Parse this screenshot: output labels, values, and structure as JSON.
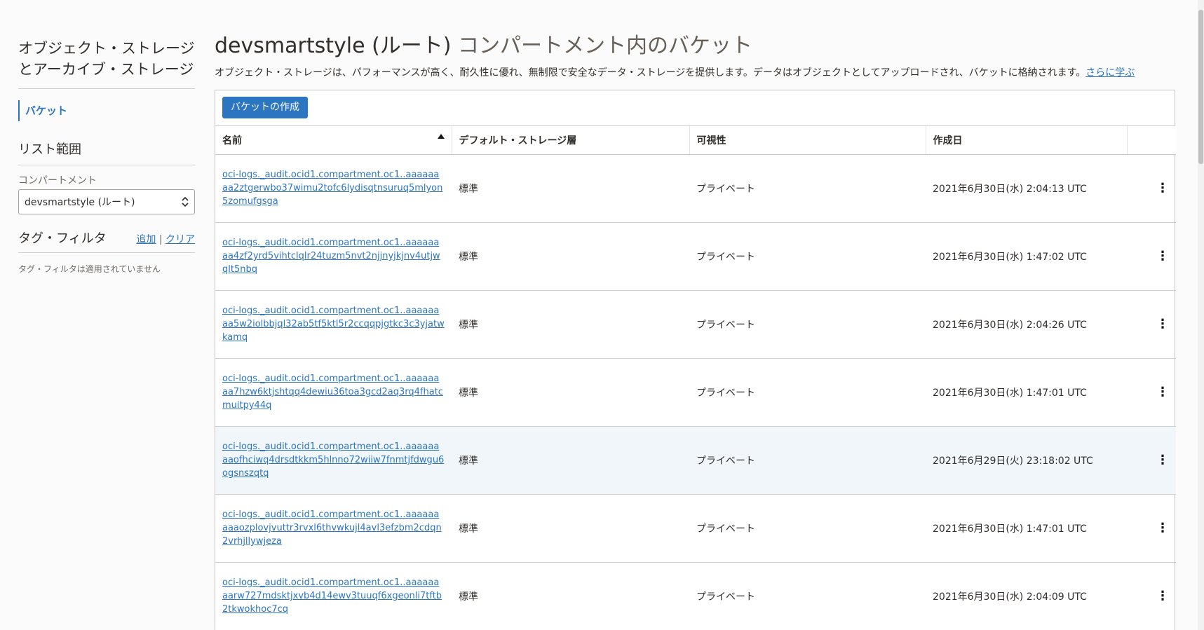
{
  "sidebar": {
    "title_line1": "オブジェクト・ストレージ",
    "title_line2": "とアーカイブ・ストレージ",
    "nav_buckets": "バケット",
    "list_scope": "リスト範囲",
    "compartment_label": "コンパートメント",
    "compartment_value": "devsmartstyle (ルート)",
    "tag_filter_title": "タグ・フィルタ",
    "tag_add": "追加",
    "tag_separator": "|",
    "tag_clear": "クリア",
    "tag_empty": "タグ・フィルタは適用されていません"
  },
  "main": {
    "title_compartment": "devsmartstyle (ルート)",
    "title_suffix": " コンパートメント内のバケット",
    "description": "オブジェクト・ストレージは、パフォーマンスが高く、耐久性に優れ、無制限で安全なデータ・ストレージを提供します。データはオブジェクトとしてアップロードされ、バケットに格納されます。",
    "learn_more": "さらに学ぶ",
    "create_button": "バケットの作成"
  },
  "table": {
    "headers": {
      "name": "名前",
      "tier": "デフォルト・ストレージ層",
      "visibility": "可視性",
      "created": "作成日"
    },
    "rows": [
      {
        "name": "oci-logs._audit.ocid1.compartment.oc1..aaaaaaaa2ztgerwbo37wimu2tofc6lydisqtnsuruq5mlyon5zomufgsga",
        "tier": "標準",
        "visibility": "プライベート",
        "created": "2021年6月30日(水) 2:04:13 UTC"
      },
      {
        "name": "oci-logs._audit.ocid1.compartment.oc1..aaaaaaaa4zf2yrd5vihtclqlr24tuzm5nvt2njjnyjkjnv4utjwqlt5nbq",
        "tier": "標準",
        "visibility": "プライベート",
        "created": "2021年6月30日(水) 1:47:02 UTC"
      },
      {
        "name": "oci-logs._audit.ocid1.compartment.oc1..aaaaaaaa5w2iolbbjql32ab5tf5ktl5r2ccqqpjgtkc3c3yjatwkamq",
        "tier": "標準",
        "visibility": "プライベート",
        "created": "2021年6月30日(水) 2:04:26 UTC"
      },
      {
        "name": "oci-logs._audit.ocid1.compartment.oc1..aaaaaaaa7hzw6ktjshtqq4dewiu36toa3gcd2aq3rq4fhatcmuitpy44q",
        "tier": "標準",
        "visibility": "プライベート",
        "created": "2021年6月30日(水) 1:47:01 UTC"
      },
      {
        "name": "oci-logs._audit.ocid1.compartment.oc1..aaaaaaaaofhciwq4drsdtkkm5hlnno72wiiw7fnmtjfdwgu6ogsnszqtq",
        "tier": "標準",
        "visibility": "プライベート",
        "created": "2021年6月29日(火) 23:18:02 UTC"
      },
      {
        "name": "oci-logs._audit.ocid1.compartment.oc1..aaaaaaaaaozplovjvuttr3rvxl6thvwkujl4avl3efzbm2cdqn2vrhjllywjeza",
        "tier": "標準",
        "visibility": "プライベート",
        "created": "2021年6月30日(水) 1:47:01 UTC"
      },
      {
        "name": "oci-logs._audit.ocid1.compartment.oc1..aaaaaaaarw727mdsktjxvb4d14ewv3tuuqf6xgeonli7tftb2tkwokhoc7cq",
        "tier": "標準",
        "visibility": "プライベート",
        "created": "2021年6月30日(水) 2:04:09 UTC"
      }
    ]
  },
  "colors": {
    "accent": "#2c75c1",
    "text": "#312d2a",
    "muted": "#6f6a64",
    "row_hover": "#f1f6fb"
  },
  "icons": {
    "sort": "sort-ascending-icon",
    "row_menu": "kebab-menu-icon",
    "select": "select-updown-icon"
  }
}
